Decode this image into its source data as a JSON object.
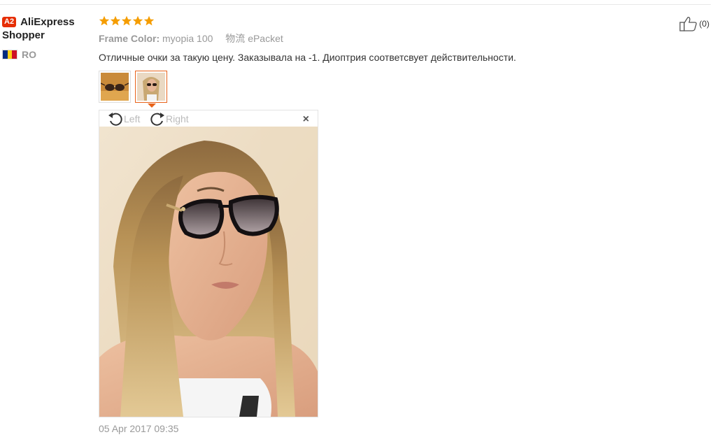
{
  "buyer": {
    "level_badge": "A2",
    "name": "AliExpress Shopper",
    "country": "RO"
  },
  "feedback": {
    "rating": 5,
    "star_color": "#f59d00",
    "attr_label": "Frame Color:",
    "attr_value": "myopia 100",
    "shipping_label": "物流",
    "shipping_value": "ePacket",
    "text": "Отличные очки за такую цену. Заказывала на -1. Диоптрия соответсвует действительности.",
    "date": "05 Apr 2017 09:35",
    "helpful_count": "(0)"
  },
  "viewer": {
    "rotate_left_label": "Left",
    "rotate_right_label": "Right",
    "close_label": "×",
    "selected_thumb": 2
  },
  "colors": {
    "accent": "#e8631a",
    "badge": "#e62e04"
  }
}
